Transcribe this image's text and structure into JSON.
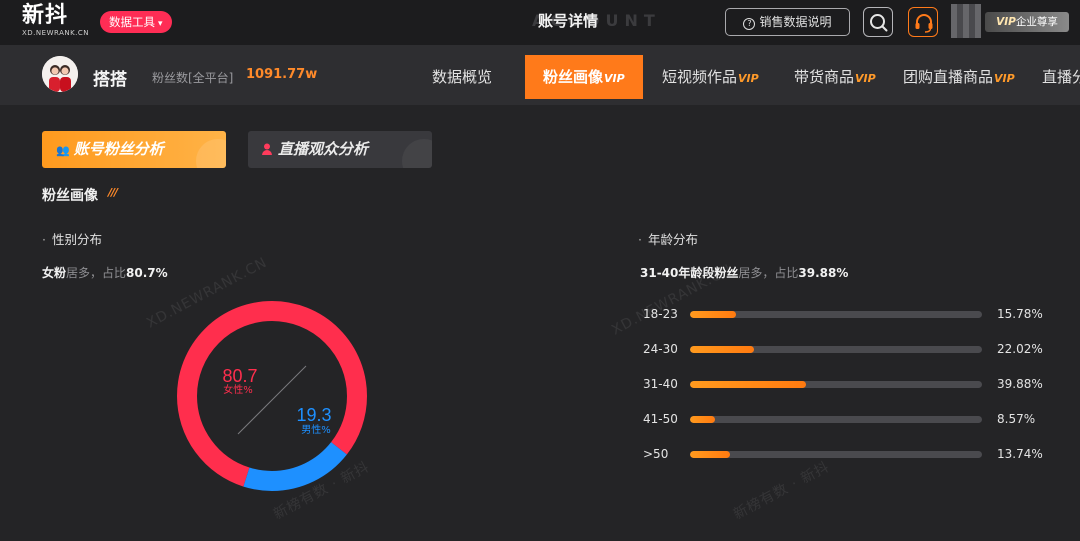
{
  "topbar": {
    "logo": "新抖",
    "logo_sub": "XD.NEWRANK.CN",
    "tools_label": "数据工具",
    "page_title": "账号详情",
    "page_title_ghost": "ACCOUNT",
    "help_label": "销售数据说明",
    "vip_label": "VIP",
    "vip_sub": "企业尊享"
  },
  "account": {
    "name": "搭搭",
    "fans_label": "粉丝数[全平台]",
    "fans_value": "1091.77w"
  },
  "nav": {
    "tabs": [
      {
        "label": "数据概览",
        "vip": ""
      },
      {
        "label": "粉丝画像",
        "vip": "VIP"
      },
      {
        "label": "短视频作品",
        "vip": "VIP"
      },
      {
        "label": "带货商品",
        "vip": "VIP"
      },
      {
        "label": "团购直播商品",
        "vip": "VIP"
      },
      {
        "label": "直播分",
        "vip": ""
      }
    ]
  },
  "analysis_tabs": {
    "fans": "账号粉丝分析",
    "live": "直播观众分析"
  },
  "section": {
    "title": "粉丝画像",
    "deco": "///"
  },
  "gender": {
    "title": "性别分布",
    "summary_prefix": "女粉",
    "summary_mid": "居多，占比",
    "summary_value": "80.7%",
    "female_value": "80.7",
    "female_label": "女性%",
    "male_value": "19.3",
    "male_label": "男性%",
    "female_pct": 80.7,
    "male_pct": 19.3,
    "female_color": "#ff2e4d",
    "male_color": "#1e90ff"
  },
  "age": {
    "title": "年龄分布",
    "summary_prefix": "31-40年龄段粉丝",
    "summary_mid": "居多，占比",
    "summary_value": "39.88%",
    "rows": [
      {
        "label": "18-23",
        "value": 15.78,
        "pct": "15.78%"
      },
      {
        "label": "24-30",
        "value": 22.02,
        "pct": "22.02%"
      },
      {
        "label": "31-40",
        "value": 39.88,
        "pct": "39.88%"
      },
      {
        "label": "41-50",
        "value": 8.57,
        "pct": "8.57%"
      },
      {
        "label": ">50",
        "value": 13.74,
        "pct": "13.74%"
      }
    ]
  },
  "watermark": {
    "site": "XD.NEWRANK.CN",
    "text": "新榜有数 · 新抖"
  }
}
